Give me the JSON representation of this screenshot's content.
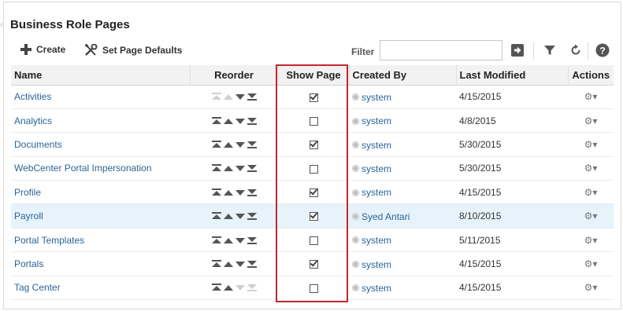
{
  "panel": {
    "title": "Business Role Pages"
  },
  "toolbar": {
    "create_label": "Create",
    "set_defaults_label": "Set Page Defaults",
    "filter_label": "Filter",
    "filter_value": ""
  },
  "columns": {
    "name": "Name",
    "reorder": "Reorder",
    "show_page": "Show Page",
    "created_by": "Created By",
    "last_modified": "Last Modified",
    "actions": "Actions"
  },
  "rows": [
    {
      "name": "Activities",
      "show": true,
      "created_by": "system",
      "modified": "4/15/2015",
      "first": true,
      "last": false,
      "selected": false
    },
    {
      "name": "Analytics",
      "show": false,
      "created_by": "system",
      "modified": "4/8/2015",
      "first": false,
      "last": false,
      "selected": false
    },
    {
      "name": "Documents",
      "show": true,
      "created_by": "system",
      "modified": "5/30/2015",
      "first": false,
      "last": false,
      "selected": false
    },
    {
      "name": "WebCenter Portal Impersonation",
      "show": false,
      "created_by": "system",
      "modified": "5/30/2015",
      "first": false,
      "last": false,
      "selected": false
    },
    {
      "name": "Profile",
      "show": true,
      "created_by": "system",
      "modified": "4/15/2015",
      "first": false,
      "last": false,
      "selected": false
    },
    {
      "name": "Payroll",
      "show": true,
      "created_by": "Syed Antari",
      "modified": "8/10/2015",
      "first": false,
      "last": false,
      "selected": true
    },
    {
      "name": "Portal Templates",
      "show": false,
      "created_by": "system",
      "modified": "5/11/2015",
      "first": false,
      "last": false,
      "selected": false
    },
    {
      "name": "Portals",
      "show": true,
      "created_by": "system",
      "modified": "4/15/2015",
      "first": false,
      "last": false,
      "selected": false
    },
    {
      "name": "Tag Center",
      "show": false,
      "created_by": "system",
      "modified": "4/15/2015",
      "first": false,
      "last": true,
      "selected": false
    }
  ],
  "colors": {
    "link": "#2a6496",
    "highlight_border": "#c0282e",
    "selected_row": "#e6f3fb",
    "header_bg": "#f2f2f2"
  },
  "icons": {
    "create": "plus-icon",
    "set_defaults": "wrench-screwdriver-icon",
    "filter_go": "arrow-right-icon",
    "filter": "funnel-icon",
    "refresh": "refresh-icon",
    "help": "help-icon",
    "actions": "gear-icon"
  }
}
